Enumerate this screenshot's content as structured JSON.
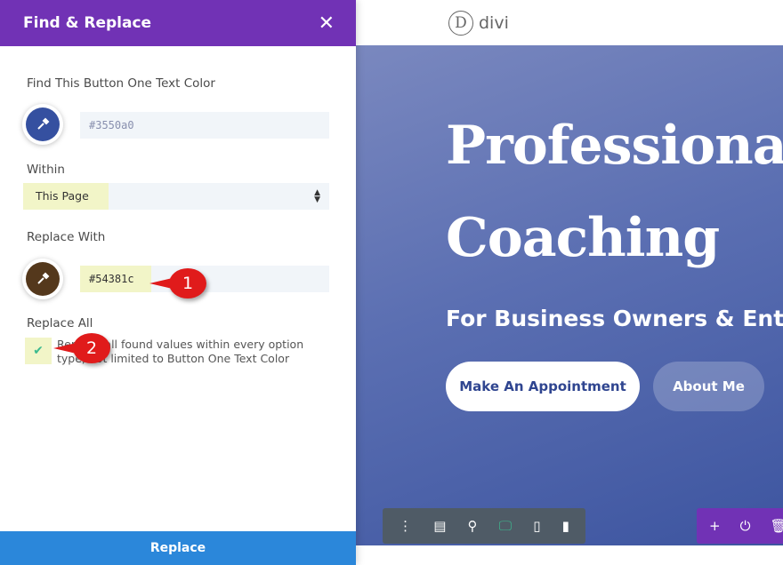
{
  "panel": {
    "title": "Find & Replace",
    "find_label": "Find This Button One Text Color",
    "find_value": "#3550a0",
    "find_color": "#3550a0",
    "within_label": "Within",
    "within_value": "This Page",
    "replace_label": "Replace With",
    "replace_value": "#54381c",
    "replace_color": "#54381c",
    "replace_all_label": "Replace All",
    "replace_all_checked": true,
    "replace_all_desc": "Replace all found values within every option type, not limited to Button One Text Color",
    "replace_button": "Replace"
  },
  "callouts": [
    "1",
    "2"
  ],
  "site": {
    "logo_letter": "D",
    "logo_text": "divi",
    "heading_line1": "Professional",
    "heading_line2": "Coaching",
    "subheading": "For Business Owners & Entrepreneurs",
    "button_primary": "Make An Appointment",
    "button_secondary": "About Me"
  },
  "colors": {
    "header": "#7132b5",
    "replace_button": "#2b87da",
    "active_view": "#3cba8f"
  },
  "toolbar": {
    "icons": [
      "more-icon",
      "layout-icon",
      "zoom-icon",
      "desktop-icon",
      "tablet-icon",
      "phone-icon"
    ],
    "active": "desktop-icon",
    "right_icons": [
      "add-icon",
      "power-icon",
      "trash-icon"
    ]
  }
}
